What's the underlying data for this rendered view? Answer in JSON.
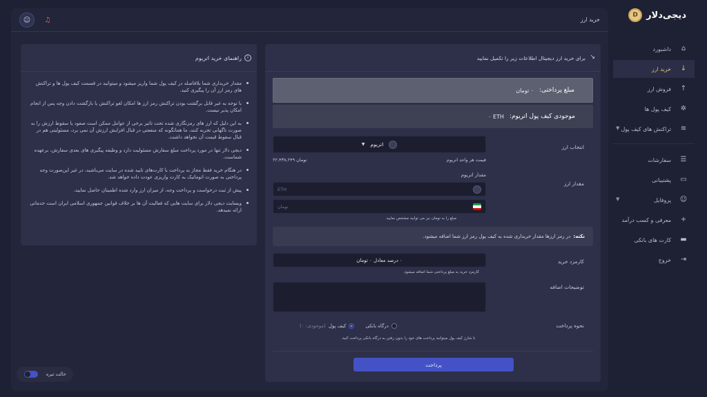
{
  "brand": {
    "name": "دیجی‌دلار",
    "logo_glyph": "D"
  },
  "topbar": {
    "title": "خرید ارز",
    "user_icon": "user-icon",
    "bell_icon": "bell-off-icon"
  },
  "sidebar": {
    "items": [
      {
        "label": "داشبورد",
        "icon": "⌂",
        "active": false
      },
      {
        "label": "خرید ارز",
        "icon": "↓",
        "active": true
      },
      {
        "label": "فروش ارز",
        "icon": "↑",
        "active": false
      },
      {
        "label": "کیف پول ها",
        "icon": "✲",
        "active": false
      },
      {
        "label": "تراکنش های کیف پول",
        "icon": "≋",
        "active": false,
        "has_chevron": true
      }
    ],
    "items2": [
      {
        "label": "سفارشات",
        "icon": "☰"
      },
      {
        "label": "پشتیبانی",
        "icon": "▭"
      },
      {
        "label": "پروفایل",
        "icon": "☺",
        "has_chevron": true
      },
      {
        "label": "معرفی و کسب درآمد",
        "icon": "+"
      },
      {
        "label": "کارت های بانکی",
        "icon": "▬"
      },
      {
        "label": "خروج",
        "icon": "⇥"
      }
    ]
  },
  "guide": {
    "title": "راهنمای خرید اتریوم",
    "items": [
      "مقدار خریداری شما بلافاصله در کیف پول شما واریز میشود و میتوانید در قسمت کیف پول ها و تراکنش های رمز ارز آن را پیگیری کنید.",
      "با توجه به غیر قابل برگشت بودن تراکنش رمز ارز ها امکان لغو تراکنش یا بازگشت دادن وجه پس از انجام امکان پذیر نیست.",
      "به این دلیل که ارز های رمزنگاری شده تحت تاثیر برخی از عوامل ممکن است صعود یا سقوط ارزش را به صورت ناگهانی تجربه کنند، ما همانگونه که منفعتی در قبال افزایش ارزش آن نمی برد، مسئولیتی هم در قبال سقوط قیمت آن نخواهد داشت.",
      "دیجی دلار تنها در مورد پرداخت مبلغ سفارش مسئولیت دارد و وظیفه پیگیری های بعدی سفارش، برعهده شماست.",
      "در هنگام خرید فقط مجاز به پرداخت با کارت‌های تایید شده در سایت می‌باشید، در غیر این‌صورت وجه پرداختی به صورت اتوماتیک به کارت واریزی عودت داده خواهد شد.",
      "پیش از ثبت درخواست و پرداخت وجه، از میزان ارز وارد شده اطمینان حاصل نمایید.",
      "وبسایت دیجی دلار برای سایت هایی که فعالیت آن ها بر خلاف قوانین جمهوری اسلامی ایران است خدماتی ارائه نمیدهد."
    ]
  },
  "form": {
    "header": "برای خرید ارز دیجیتال اطلاعات زیر را تکمیل نمایید",
    "payable_label": "مبلغ پرداختی:",
    "payable_value": "۰ تومان",
    "balance_label": "موجودی کیف پول اتریوم:",
    "balance_value": "۰ ETH",
    "asset_label": "انتخاب ارز",
    "asset_selected": "اتریوم",
    "unit_price_label": "قیمت هر واحد اتریوم",
    "unit_price_value": "۲۲,۴۳۸,۲۴۹ تومان",
    "amount_label": "مقدار ارز",
    "amount_sublabel": "مقدار اتریوم",
    "eth_placeholder": "ETH",
    "toman_placeholder": "تومان",
    "toman_hint": "مبلغ را به تومان نیز می توانید مشخص نمایید.",
    "note_title": "نکته:",
    "note_text": "در رمز ارزها مقدار خریداری شده به کیف پول رمز ارز شما اضافه میشود.",
    "fee_label": "کارمزد خرید",
    "fee_value": "۰ درصد معادل ۰ تومان",
    "fee_hint": "کارمزد خرید به مبلغ پرداختی شما اضافه میشود.",
    "desc_label": "توضیحات اضافه",
    "method_label": "نحوه پرداخت",
    "method_gateway": "درگاه بانکی",
    "method_wallet": "کیف پول",
    "method_wallet_balance": "(موجودی: ۰)",
    "method_hint": "با شارژ کیف پول میتوانید پرداخت های خود را بدون رفتن به درگاه بانکی پرداخت کنید.",
    "pay_button": "پرداخت"
  },
  "dark_mode": {
    "label": "حالت تیره",
    "on": true
  },
  "colors": {
    "accent": "#4452c5",
    "active_nav": "#e5c070",
    "bg": "#1e2033"
  }
}
